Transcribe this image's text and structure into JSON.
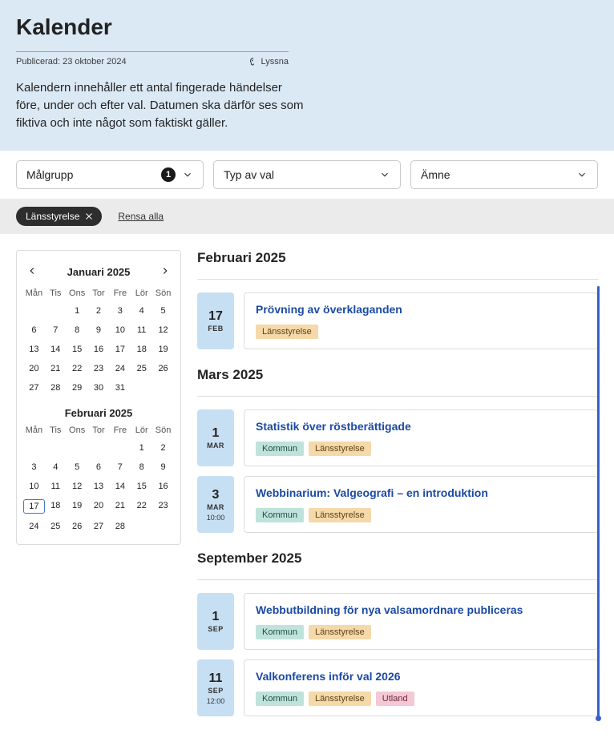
{
  "hero": {
    "title": "Kalender",
    "published_label": "Publicerad: 23 oktober 2024",
    "listen": "Lyssna",
    "intro": "Kalendern innehåller ett antal fingerade händelser före, under och efter val. Datumen ska därför ses som fiktiva och inte något som faktiskt gäller."
  },
  "filters": {
    "målgrupp": {
      "label": "Målgrupp",
      "count": "1"
    },
    "typ": {
      "label": "Typ av val"
    },
    "amne": {
      "label": "Ämne"
    }
  },
  "chips": {
    "items": [
      {
        "label": "Länsstyrelse"
      }
    ],
    "clear": "Rensa alla"
  },
  "calendar": {
    "month1": {
      "title": "Januari 2025",
      "weekdays": [
        "Mån",
        "Tis",
        "Ons",
        "Tor",
        "Fre",
        "Lör",
        "Sön"
      ],
      "offset": 2,
      "days": 31,
      "selected": null
    },
    "month2": {
      "title": "Februari 2025",
      "weekdays": [
        "Mån",
        "Tis",
        "Ons",
        "Tor",
        "Fre",
        "Lör",
        "Sön"
      ],
      "offset": 5,
      "days": 28,
      "selected": 17
    }
  },
  "months": [
    {
      "heading": "Februari 2025",
      "events": [
        {
          "day": "17",
          "mon": "FEB",
          "time": null,
          "title": "Prövning av överklaganden",
          "tags": [
            "lans"
          ]
        }
      ]
    },
    {
      "heading": "Mars 2025",
      "events": [
        {
          "day": "1",
          "mon": "MAR",
          "time": null,
          "title": "Statistik över röstberättigade",
          "tags": [
            "kommun",
            "lans"
          ]
        },
        {
          "day": "3",
          "mon": "MAR",
          "time": "10:00",
          "title": "Webbinarium: Valgeografi – en introduktion",
          "tags": [
            "kommun",
            "lans"
          ]
        }
      ]
    },
    {
      "heading": "September 2025",
      "events": [
        {
          "day": "1",
          "mon": "SEP",
          "time": null,
          "title": "Webbutbildning för nya valsamordnare publiceras",
          "tags": [
            "kommun",
            "lans"
          ]
        },
        {
          "day": "11",
          "mon": "SEP",
          "time": "12:00",
          "title": "Valkonferens inför val 2026",
          "tags": [
            "kommun",
            "lans",
            "utland"
          ]
        }
      ]
    }
  ],
  "tag_labels": {
    "kommun": "Kommun",
    "lans": "Länsstyrelse",
    "utland": "Utland"
  }
}
